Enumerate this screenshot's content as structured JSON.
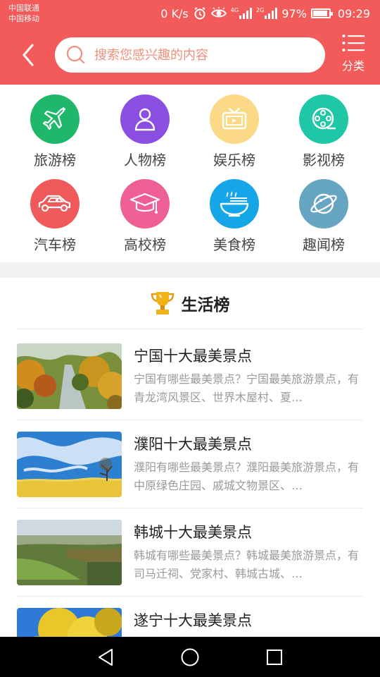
{
  "status_bar": {
    "carrier_1": "中国联通",
    "carrier_2": "中国移动",
    "net_speed": "0 K/s",
    "signal_1_label": "4G",
    "signal_2_label": "2G",
    "battery": "97%",
    "time": "09:29"
  },
  "header": {
    "search_placeholder": "搜索您感兴趣的内容",
    "category_label": "分类",
    "bg_color": "#f35a5a"
  },
  "categories": [
    {
      "label": "旅游榜",
      "icon": "airplane-icon",
      "color": "#1fb86a"
    },
    {
      "label": "人物榜",
      "icon": "person-icon",
      "color": "#8a4fe0"
    },
    {
      "label": "娱乐榜",
      "icon": "tv-icon",
      "color": "#fbd987"
    },
    {
      "label": "影视榜",
      "icon": "film-reel-icon",
      "color": "#1ec7a5"
    },
    {
      "label": "汽车榜",
      "icon": "car-icon",
      "color": "#ef5959"
    },
    {
      "label": "高校榜",
      "icon": "graduation-cap-icon",
      "color": "#ee5f93"
    },
    {
      "label": "美食榜",
      "icon": "noodle-bowl-icon",
      "color": "#14a6e6"
    },
    {
      "label": "趣闻榜",
      "icon": "planet-icon",
      "color": "#67a6c2"
    }
  ],
  "section": {
    "title": "生活榜",
    "icon": "trophy-icon"
  },
  "items": [
    {
      "title": "宁国十大最美景点",
      "desc": "宁国有哪些最美景点？宁国最美旅游景点，有青龙湾风景区、世界木屋村、夏…"
    },
    {
      "title": "濮阳十大最美景点",
      "desc": "濮阳有哪些最美景点？濮阳最美旅游景点，有中原绿色庄园、戚城文物景区、…"
    },
    {
      "title": "韩城十大最美景点",
      "desc": "韩城有哪些最美景点？韩城最美旅游景点，有司马迁祠、党家村、韩城古城、…"
    },
    {
      "title": "遂宁十大最美景点",
      "desc": ""
    }
  ]
}
